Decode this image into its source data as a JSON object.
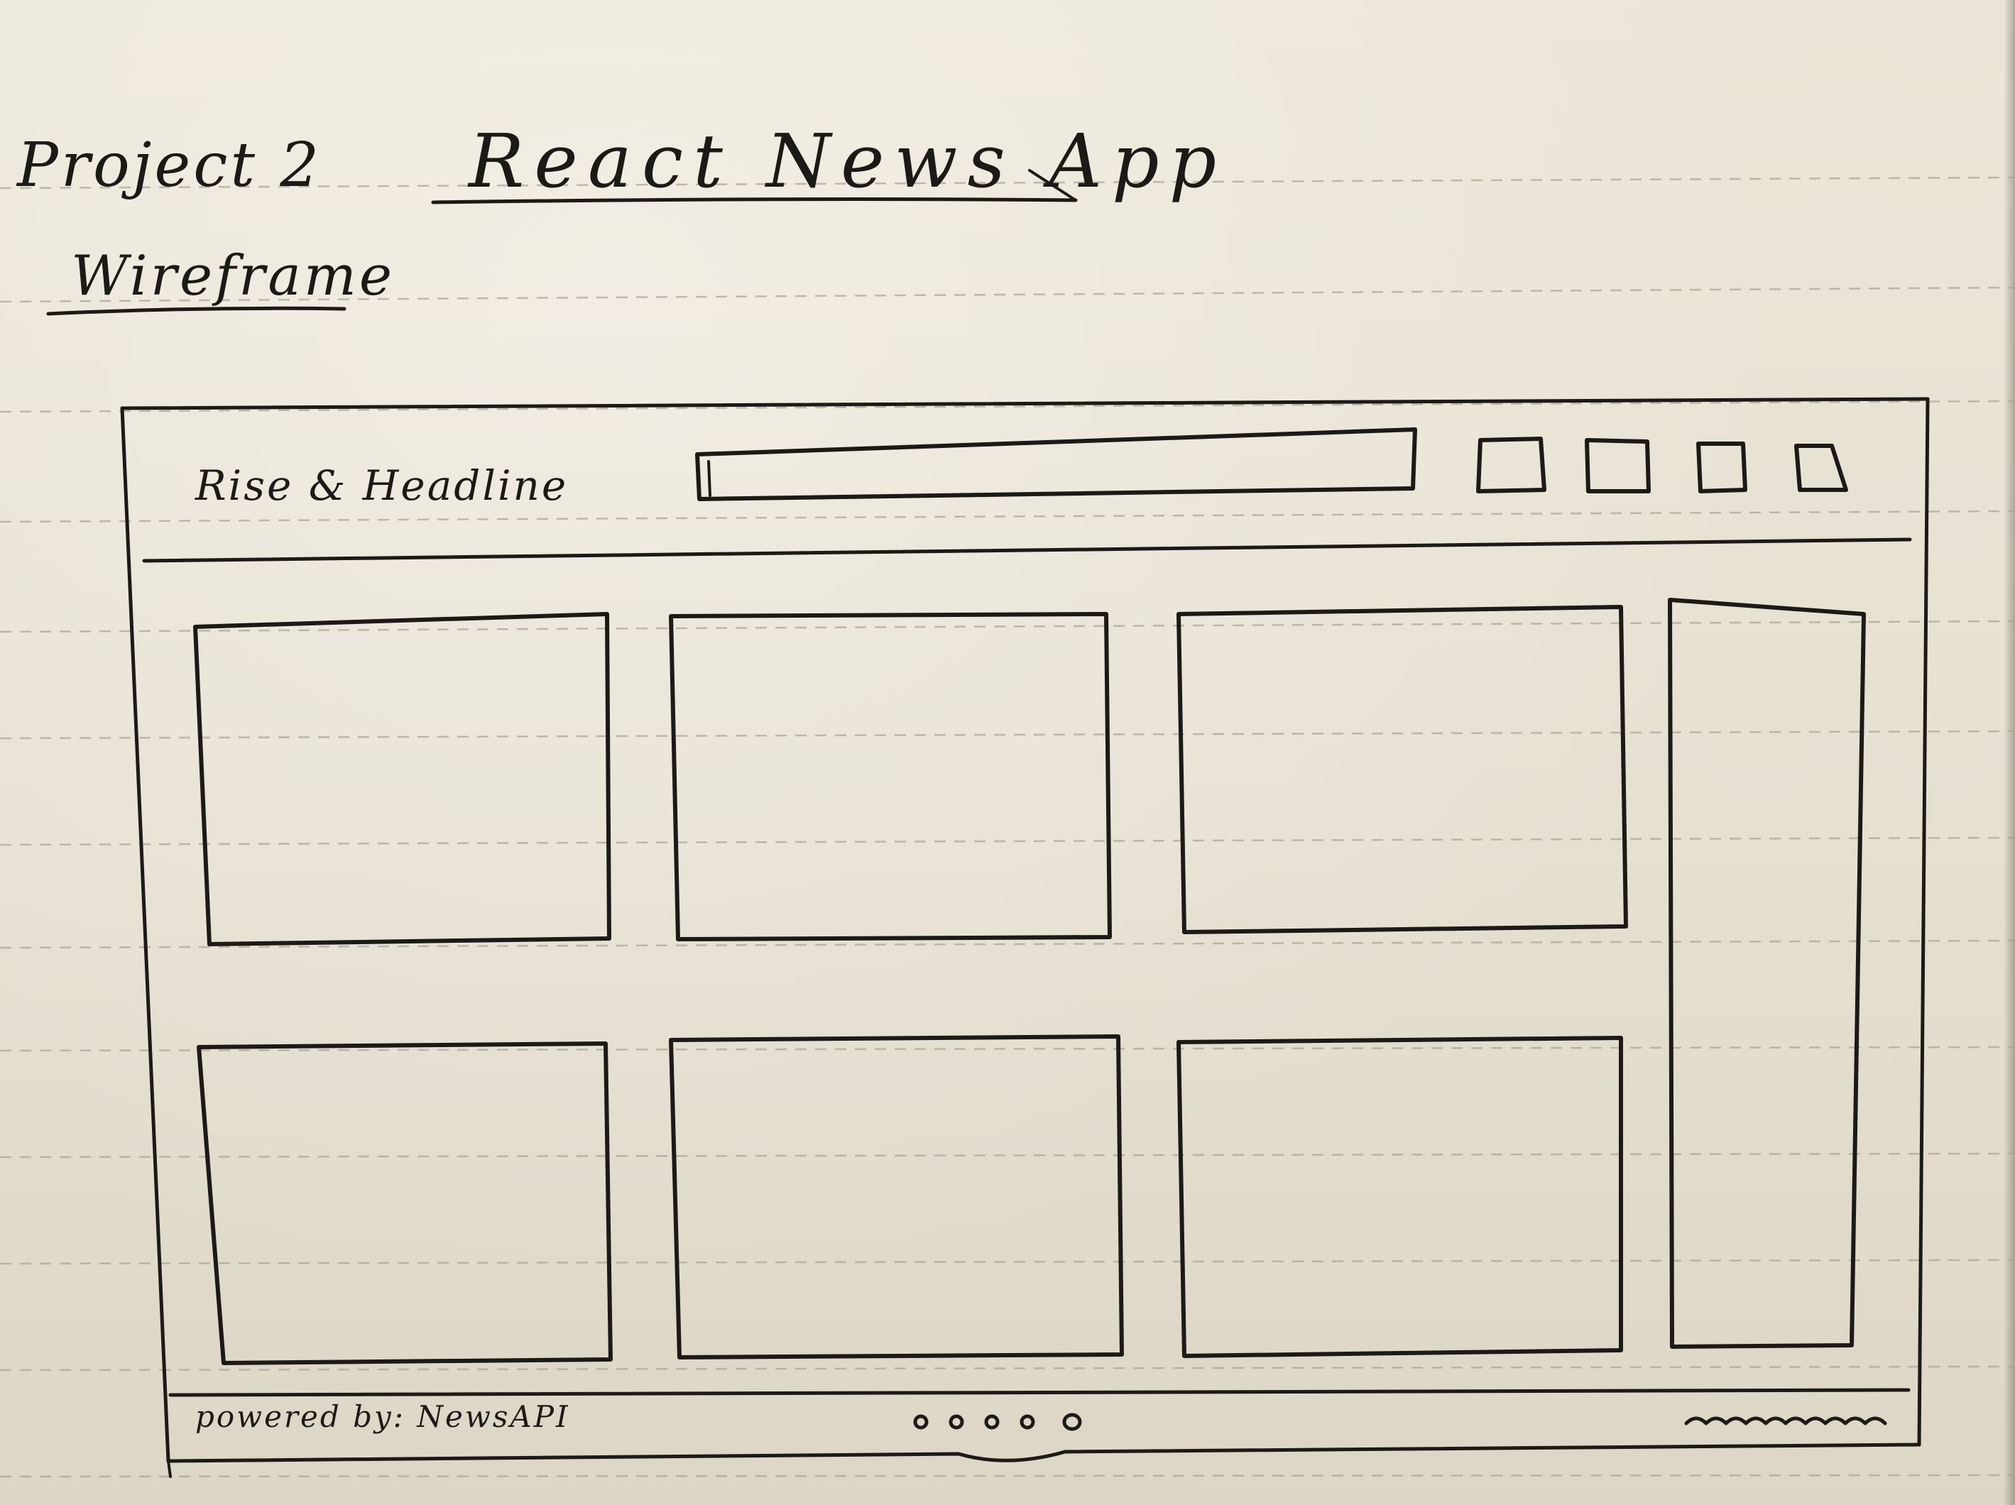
{
  "header": {
    "note_label": "Project 2",
    "app_title": "React News App",
    "doc_type": "Wireframe"
  },
  "wireframe": {
    "brand_name": "Rise & Headline",
    "search_bar": "search-bar",
    "nav_icons": [
      {
        "name": "nav-button-1"
      },
      {
        "name": "nav-button-2"
      },
      {
        "name": "nav-button-3"
      },
      {
        "name": "nav-button-4"
      }
    ],
    "article_cards": [
      {
        "name": "article-card-1"
      },
      {
        "name": "article-card-2"
      },
      {
        "name": "article-card-3"
      },
      {
        "name": "article-card-4"
      },
      {
        "name": "article-card-5"
      },
      {
        "name": "article-card-6"
      }
    ],
    "sidebar": "sidebar-panel",
    "footer": {
      "credit": "powered by: NewsAPI",
      "pagination_dots": 5
    }
  },
  "colors": {
    "paper": "#e8e2d4",
    "ink": "#1c1a16",
    "rule_line": "#a9a294"
  }
}
